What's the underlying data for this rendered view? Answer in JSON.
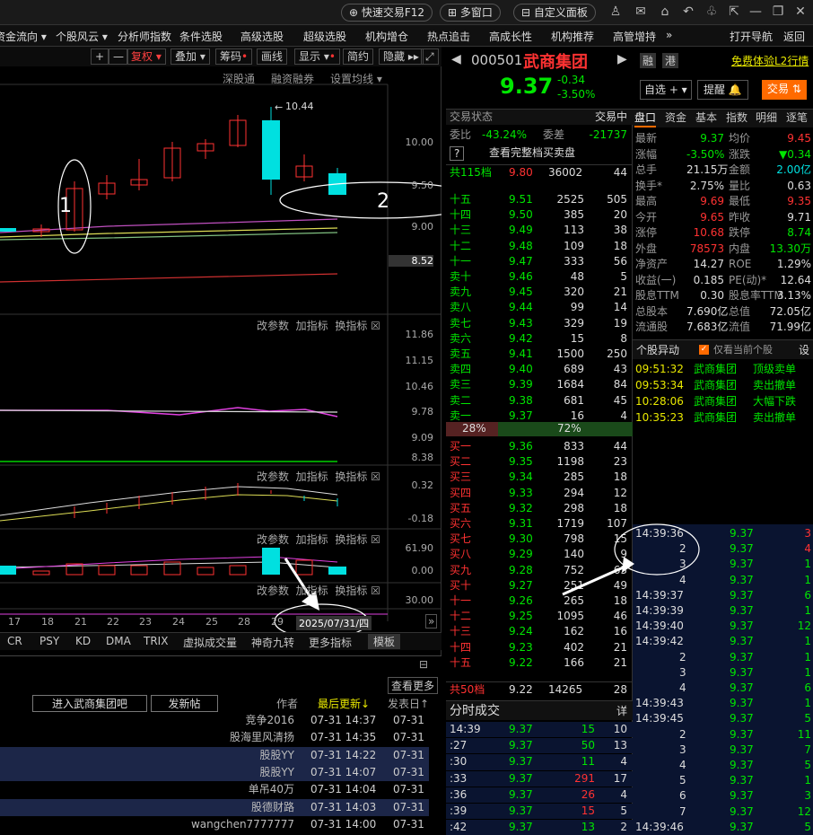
{
  "topbar": {
    "quick_trade": "快速交易F12",
    "multi_window": "多窗口",
    "custom_panel": "自定义面板"
  },
  "menubar": [
    "资金流向 ▾",
    "个股风云 ▾",
    "分析师指数",
    "条件选股",
    "高级选股",
    "超级选股",
    "机构增仓",
    "热点追击",
    "高成长性",
    "机构推荐",
    "高管增持",
    "»",
    "打开导航",
    "返回"
  ],
  "chart": {
    "toolbar": [
      "+",
      "—",
      "复权",
      "叠加",
      "筹码",
      "画线",
      "显示",
      "简约",
      "隐藏"
    ],
    "subtool": [
      "深股通",
      "融资融券",
      "设置均线 ▾"
    ],
    "price_axis": [
      "10.00",
      "9.50",
      "9.00",
      "8.52"
    ],
    "high_label": "10.44",
    "ind_labels": [
      "改参数",
      "加指标",
      "换指标"
    ],
    "ind_axis_1": [
      "11.86",
      "11.15",
      "10.46",
      "9.78",
      "9.09",
      "8.38"
    ],
    "ind_axis_2": [
      "0.32",
      "-0.18"
    ],
    "ind_axis_3": [
      "61.90",
      "0.00"
    ],
    "ind_axis_4": [
      "30.00"
    ],
    "dates": [
      "17",
      "18",
      "21",
      "22",
      "23",
      "24",
      "25",
      "28",
      "29"
    ],
    "cursor_date": "2025/07/31/四",
    "tabs": [
      "CR",
      "PSY",
      "KD",
      "DMA",
      "TRIX",
      "虚拟成交量",
      "神奇九转",
      "更多指标",
      "模板"
    ],
    "annot_1": "1",
    "annot_2": "2"
  },
  "forum": {
    "check_more": "查看更多",
    "enter_bar": "进入武商集团吧",
    "post": "发新帖",
    "h_author": "作者",
    "h_updated": "最后更新↓",
    "h_posted": "发表日↑",
    "rows": [
      {
        "author": "竞争2016",
        "t": "07-31 14:37",
        "d": "07-31"
      },
      {
        "author": "股海里风清扬",
        "t": "07-31 14:35",
        "d": "07-31"
      },
      {
        "author": "股股YY",
        "t": "07-31 14:22",
        "d": "07-31"
      },
      {
        "author": "股股YY",
        "t": "07-31 14:07",
        "d": "07-31"
      },
      {
        "author": "单吊40万",
        "t": "07-31 14:04",
        "d": "07-31"
      },
      {
        "author": "股德财路",
        "t": "07-31 14:03",
        "d": "07-31"
      },
      {
        "author": "wangchen7777777",
        "t": "07-31 14:00",
        "d": "07-31"
      }
    ]
  },
  "quote": {
    "code": "000501",
    "name": "武商集团",
    "price": "9.37",
    "change": "-0.34",
    "pct": "-3.50%",
    "tag1": "融",
    "tag2": "港",
    "promo": "免费体验L2行情",
    "watch": "自选 + ▾",
    "alert": "提醒",
    "trade": "交易"
  },
  "book": {
    "status": "交易状态",
    "status_val": "交易中",
    "ratio_lbl": "委比",
    "ratio": "-43.24%",
    "diff_lbl": "委差",
    "diff": "-21737",
    "full": "查看完整档买卖盘",
    "sell_total": {
      "lbl": "共115档",
      "price": "9.80",
      "vol": "36002",
      "n": "44"
    },
    "sells": [
      [
        "十五",
        "9.51",
        "2525",
        "505"
      ],
      [
        "十四",
        "9.50",
        "385",
        "20"
      ],
      [
        "十三",
        "9.49",
        "113",
        "38"
      ],
      [
        "十二",
        "9.48",
        "109",
        "18"
      ],
      [
        "十一",
        "9.47",
        "333",
        "56"
      ],
      [
        "卖十",
        "9.46",
        "48",
        "5"
      ],
      [
        "卖九",
        "9.45",
        "320",
        "21"
      ],
      [
        "卖八",
        "9.44",
        "99",
        "14"
      ],
      [
        "卖七",
        "9.43",
        "329",
        "19"
      ],
      [
        "卖六",
        "9.42",
        "15",
        "8"
      ],
      [
        "卖五",
        "9.41",
        "1500",
        "250"
      ],
      [
        "卖四",
        "9.40",
        "689",
        "43"
      ],
      [
        "卖三",
        "9.39",
        "1684",
        "84"
      ],
      [
        "卖二",
        "9.38",
        "681",
        "45"
      ],
      [
        "卖一",
        "9.37",
        "16",
        "4"
      ]
    ],
    "bar_left": "28%",
    "bar_right": "72%",
    "buys": [
      [
        "买一",
        "9.36",
        "833",
        "44"
      ],
      [
        "买二",
        "9.35",
        "1198",
        "23"
      ],
      [
        "买三",
        "9.34",
        "285",
        "18"
      ],
      [
        "买四",
        "9.33",
        "294",
        "12"
      ],
      [
        "买五",
        "9.32",
        "298",
        "18"
      ],
      [
        "买六",
        "9.31",
        "1719",
        "107"
      ],
      [
        "买七",
        "9.30",
        "798",
        "15"
      ],
      [
        "买八",
        "9.29",
        "140",
        "9"
      ],
      [
        "买九",
        "9.28",
        "752",
        "63"
      ],
      [
        "买十",
        "9.27",
        "251",
        "49"
      ],
      [
        "十一",
        "9.26",
        "265",
        "18"
      ],
      [
        "十二",
        "9.25",
        "1095",
        "46"
      ],
      [
        "十三",
        "9.24",
        "162",
        "16"
      ],
      [
        "十四",
        "9.23",
        "402",
        "21"
      ],
      [
        "十五",
        "9.22",
        "166",
        "21"
      ]
    ],
    "buy_total": {
      "lbl": "共50档",
      "price": "9.22",
      "vol": "14265",
      "n": "28"
    },
    "fenshi": "分时成交",
    "detail": "详",
    "trades": [
      [
        "14:39",
        "9.37",
        "15",
        "10"
      ],
      [
        ":27",
        "9.37",
        "50",
        "13"
      ],
      [
        ":30",
        "9.37",
        "11",
        "4"
      ],
      [
        ":33",
        "9.37",
        "291",
        "17"
      ],
      [
        ":36",
        "9.37",
        "26",
        "4"
      ],
      [
        ":39",
        "9.37",
        "15",
        "5"
      ],
      [
        ":42",
        "9.37",
        "13",
        "2"
      ]
    ]
  },
  "info": {
    "tabs": [
      "盘口",
      "资金",
      "基本",
      "指数",
      "明细",
      "逐笔"
    ],
    "rows": [
      [
        "最新",
        "9.37",
        "均价",
        "9.45"
      ],
      [
        "涨幅",
        "-3.50%",
        "涨跌",
        "▼0.34"
      ],
      [
        "总手",
        "21.15万",
        "金额",
        "2.00亿"
      ],
      [
        "换手*",
        "2.75%",
        "量比",
        "0.63"
      ],
      [
        "最高",
        "9.69",
        "最低",
        "9.35"
      ],
      [
        "今开",
        "9.65",
        "昨收",
        "9.71"
      ],
      [
        "涨停",
        "10.68",
        "跌停",
        "8.74"
      ],
      [
        "外盘",
        "78573",
        "内盘",
        "13.30万"
      ],
      [
        "净资产",
        "14.27",
        "ROE",
        "1.29%"
      ],
      [
        "收益(一)",
        "0.185",
        "PE(动)*",
        "12.64"
      ],
      [
        "股息TTM",
        "0.30",
        "股息率TTM",
        "3.13%"
      ],
      [
        "总股本",
        "7.690亿",
        "总值",
        "72.05亿"
      ],
      [
        "流通股",
        "7.683亿",
        "流值",
        "71.99亿"
      ]
    ],
    "movers_title": "个股异动",
    "movers_check": "仅看当前个股",
    "movers_set": "设",
    "movers": [
      [
        "09:51:32",
        "武商集团",
        "顶级卖单"
      ],
      [
        "09:53:34",
        "武商集团",
        "卖出撤单"
      ],
      [
        "10:28:06",
        "武商集团",
        "大幅下跌"
      ],
      [
        "10:35:23",
        "武商集团",
        "卖出撤单"
      ]
    ],
    "ticks": [
      [
        "14:39:36",
        "9.37",
        "3"
      ],
      [
        "2",
        "9.37",
        "4"
      ],
      [
        "3",
        "9.37",
        "1"
      ],
      [
        "4",
        "9.37",
        "1"
      ],
      [
        "14:39:37",
        "9.37",
        "6"
      ],
      [
        "14:39:39",
        "9.37",
        "1"
      ],
      [
        "14:39:40",
        "9.37",
        "12"
      ],
      [
        "14:39:42",
        "9.37",
        "1"
      ],
      [
        "2",
        "9.37",
        "1"
      ],
      [
        "3",
        "9.37",
        "1"
      ],
      [
        "4",
        "9.37",
        "6"
      ],
      [
        "14:39:43",
        "9.37",
        "1"
      ],
      [
        "14:39:45",
        "9.37",
        "5"
      ],
      [
        "2",
        "9.37",
        "11"
      ],
      [
        "3",
        "9.37",
        "7"
      ],
      [
        "4",
        "9.37",
        "5"
      ],
      [
        "5",
        "9.37",
        "1"
      ],
      [
        "6",
        "9.37",
        "3"
      ],
      [
        "7",
        "9.37",
        "12"
      ],
      [
        "14:39:46",
        "9.37",
        "5"
      ]
    ]
  },
  "colors": {
    "up": "#ff3232",
    "down": "#00e600",
    "accent": "#ff6a00",
    "cyan": "#00e0e0"
  }
}
